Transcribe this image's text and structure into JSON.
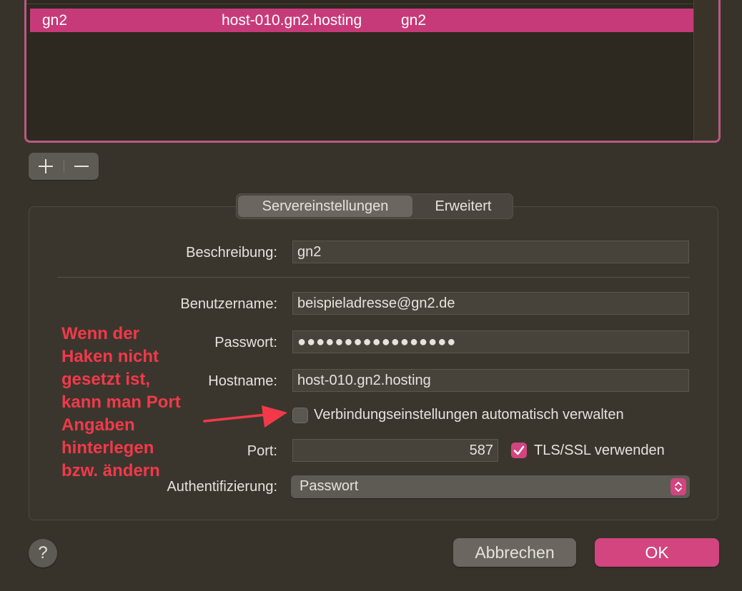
{
  "server_list": {
    "selected_row": {
      "name": "gn2",
      "host": "host-010.gn2.hosting",
      "account": "gn2"
    }
  },
  "list_controls": {
    "add_icon": "plus-icon",
    "remove_icon": "minus-icon"
  },
  "tabs": [
    {
      "label": "Servereinstellungen",
      "active": true
    },
    {
      "label": "Erweitert",
      "active": false
    }
  ],
  "form": {
    "description_label": "Beschreibung:",
    "description_value": "gn2",
    "username_label": "Benutzername:",
    "username_value": "beispieladresse@gn2.de",
    "password_label": "Passwort:",
    "password_value": "●●●●●●●●●●●●●●●●●",
    "hostname_label": "Hostname:",
    "hostname_value": "host-010.gn2.hosting",
    "auto_manage_label": "Verbindungseinstellungen automatisch verwalten",
    "auto_manage_checked": false,
    "port_label": "Port:",
    "port_value": "587",
    "tls_label": "TLS/SSL verwenden",
    "tls_checked": true,
    "auth_label": "Authentifizierung:",
    "auth_value": "Passwort"
  },
  "annotation": {
    "lines": [
      "Wenn der",
      "Haken nicht",
      "gesetzt ist,",
      "kann man Port",
      "Angaben",
      "hinterlegen",
      "bzw. ändern"
    ],
    "color": "#f2394a"
  },
  "buttons": {
    "help": "?",
    "cancel": "Abbrechen",
    "ok": "OK"
  },
  "colors": {
    "accent": "#d2457f",
    "selection": "#c73a79"
  }
}
